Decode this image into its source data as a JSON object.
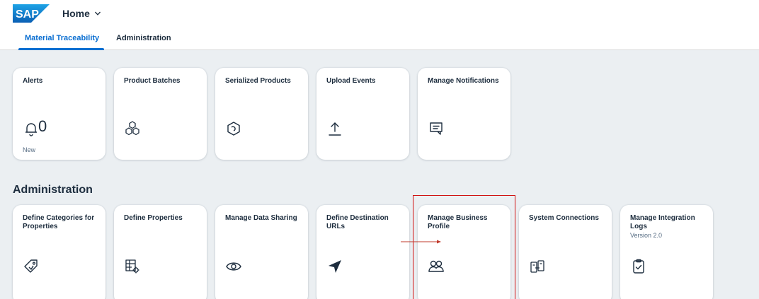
{
  "shell": {
    "logo_text": "SAP",
    "home_label": "Home",
    "home_icon": "chevron-down-icon",
    "brand_color": "#0a6ed1"
  },
  "tabs": [
    {
      "label": "Material Traceability",
      "selected": true
    },
    {
      "label": "Administration",
      "selected": false
    }
  ],
  "group1": {
    "tiles": [
      {
        "title": "Alerts",
        "icon": "bell-icon",
        "value": "0",
        "footer": "New"
      },
      {
        "title": "Product Batches",
        "icon": "batches-icon"
      },
      {
        "title": "Serialized Products",
        "icon": "serialized-product-icon"
      },
      {
        "title": "Upload Events",
        "icon": "upload-icon"
      },
      {
        "title": "Manage Notifications",
        "icon": "notification-icon"
      }
    ]
  },
  "group2": {
    "title": "Administration",
    "tiles": [
      {
        "title": "Define Categories for Properties",
        "icon": "tag-icon"
      },
      {
        "title": "Define Properties",
        "icon": "properties-icon"
      },
      {
        "title": "Manage Data Sharing",
        "icon": "eye-icon"
      },
      {
        "title": "Define Destination URLs",
        "icon": "navigation-icon"
      },
      {
        "title": "Manage Business Profile",
        "icon": "business-partners-icon",
        "highlighted": true
      },
      {
        "title": "System Connections",
        "icon": "connections-icon"
      },
      {
        "title": "Manage Integration Logs",
        "subtitle": "Version 2.0",
        "icon": "log-icon"
      }
    ]
  },
  "annotation": {
    "highlight_color": "#d01010"
  }
}
